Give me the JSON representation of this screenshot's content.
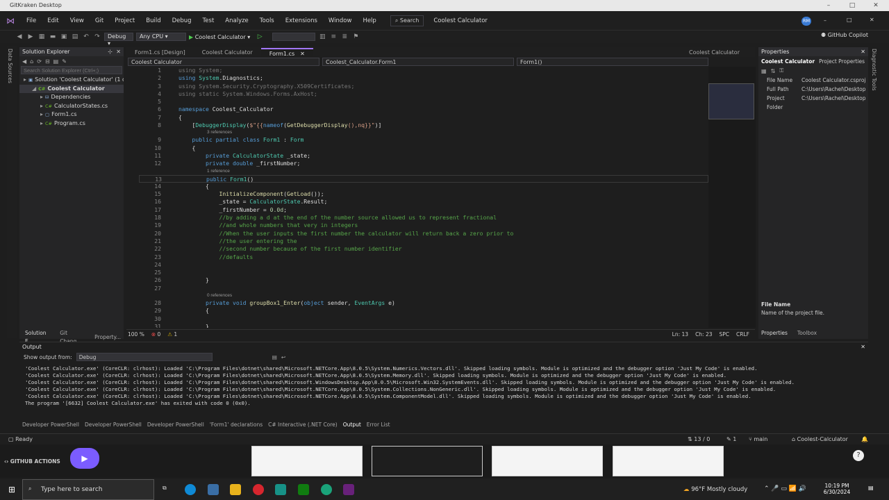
{
  "window": {
    "title": "GitKraken Desktop"
  },
  "menu": {
    "items": [
      "File",
      "Edit",
      "View",
      "Git",
      "Project",
      "Build",
      "Debug",
      "Test",
      "Analyze",
      "Tools",
      "Extensions",
      "Window",
      "Help"
    ],
    "search": "Search",
    "solution_name": "Coolest Calculator",
    "avatar": "RM",
    "copilot": "GitHub Copilot"
  },
  "toolbar": {
    "config": "Debug",
    "platform": "Any CPU",
    "run": "Coolest Calculator"
  },
  "left_strip": {
    "items": [
      "Data Sources",
      "Diagnostic Tools"
    ]
  },
  "solution_explorer": {
    "title": "Solution Explorer",
    "search_placeholder": "Search Solution Explorer (Ctrl+;)",
    "items": [
      {
        "label": "Solution 'Coolest Calculator' (1 of 1",
        "indent": 0,
        "icon": "solution-icon"
      },
      {
        "label": "Coolest Calculator",
        "indent": 1,
        "icon": "csharp-project-icon"
      },
      {
        "label": "Dependencies",
        "indent": 2,
        "icon": "dependencies-icon"
      },
      {
        "label": "CalculatorStates.cs",
        "indent": 2,
        "icon": "csharp-file-icon"
      },
      {
        "label": "Form1.cs",
        "indent": 2,
        "icon": "form-file-icon"
      },
      {
        "label": "Program.cs",
        "indent": 2,
        "icon": "csharp-file-icon"
      }
    ],
    "bottom_tabs": [
      "Solution E...",
      "Git Chang...",
      "Property..."
    ]
  },
  "editor": {
    "tabs": [
      "Form1.cs [Design]",
      "Coolest Calculator",
      "Form1.cs"
    ],
    "active_tab_index": 2,
    "right_tab": "Coolest Calculator",
    "nav": [
      "Coolest Calculator",
      "Coolest_Calculator.Form1",
      "Form1()"
    ],
    "lines": [
      {
        "n": "1",
        "t": [
          [
            "using ",
            "gr"
          ],
          [
            "System;",
            "gr"
          ]
        ]
      },
      {
        "n": "2",
        "t": [
          [
            "using ",
            "kw"
          ],
          [
            "System",
            "ty"
          ],
          [
            ".Diagnostics;",
            "d"
          ]
        ]
      },
      {
        "n": "3",
        "t": [
          [
            "using System.Security.Cryptography.X509Certificates;",
            "gr"
          ]
        ]
      },
      {
        "n": "4",
        "t": [
          [
            "using static System.Windows.Forms.AxHost;",
            "gr"
          ]
        ]
      },
      {
        "n": "5",
        "t": [
          [
            "",
            ""
          ]
        ]
      },
      {
        "n": "6",
        "t": [
          [
            "namespace ",
            "kw"
          ],
          [
            "Coolest_Calculator",
            "d"
          ]
        ]
      },
      {
        "n": "7",
        "t": [
          [
            "{",
            "d"
          ]
        ]
      },
      {
        "n": "8",
        "t": [
          [
            "    [",
            "d"
          ],
          [
            "DebuggerDisplay",
            "ty"
          ],
          [
            "(",
            "d"
          ],
          [
            "$\"{{",
            "st"
          ],
          [
            "nameof",
            "kw"
          ],
          [
            "(",
            "d"
          ],
          [
            "GetDebuggerDisplay",
            "mt"
          ],
          [
            "(),nq}}\"",
            "st"
          ],
          [
            ")]",
            "d"
          ]
        ]
      },
      {
        "ref": "3 references"
      },
      {
        "n": "9",
        "t": [
          [
            "    ",
            "d"
          ],
          [
            "public partial class ",
            "kw"
          ],
          [
            "Form1",
            "ty"
          ],
          [
            " : ",
            "d"
          ],
          [
            "Form",
            "ty"
          ]
        ]
      },
      {
        "n": "10",
        "t": [
          [
            "    {",
            "d"
          ]
        ]
      },
      {
        "n": "11",
        "t": [
          [
            "        ",
            "d"
          ],
          [
            "private ",
            "kw"
          ],
          [
            "CalculatorState",
            "ty"
          ],
          [
            " _state;",
            "d"
          ]
        ]
      },
      {
        "n": "12",
        "t": [
          [
            "        ",
            "d"
          ],
          [
            "private double ",
            "kw"
          ],
          [
            "_firstNumber;",
            "d"
          ]
        ]
      },
      {
        "ref": "1 reference"
      },
      {
        "n": "13",
        "t": [
          [
            "        ",
            "d"
          ],
          [
            "public ",
            "kw"
          ],
          [
            "Form1",
            "ty"
          ],
          [
            "()",
            "d"
          ]
        ]
      },
      {
        "n": "14",
        "t": [
          [
            "        {",
            "d"
          ]
        ]
      },
      {
        "n": "15",
        "t": [
          [
            "            ",
            "d"
          ],
          [
            "InitializeComponent",
            "mt"
          ],
          [
            "(",
            "d"
          ],
          [
            "GetLoad",
            "mt"
          ],
          [
            "());",
            "d"
          ]
        ]
      },
      {
        "n": "16",
        "t": [
          [
            "            _state = ",
            "d"
          ],
          [
            "CalculatorState",
            "ty"
          ],
          [
            ".Result;",
            "d"
          ]
        ]
      },
      {
        "n": "17",
        "t": [
          [
            "            _firstNumber = ",
            "d"
          ],
          [
            "0.0d",
            "nb"
          ],
          [
            ";",
            "d"
          ]
        ]
      },
      {
        "n": "18",
        "t": [
          [
            "            //by adding a d at the end of the number source allowed us to represent fractional",
            "cm"
          ]
        ]
      },
      {
        "n": "19",
        "t": [
          [
            "            //and whole numbers that very in integers",
            "cm"
          ]
        ]
      },
      {
        "n": "20",
        "t": [
          [
            "            //When the user inputs the first number the calculator will return back a zero prior to",
            "cm"
          ]
        ]
      },
      {
        "n": "21",
        "t": [
          [
            "            //the user entering the",
            "cm"
          ]
        ]
      },
      {
        "n": "22",
        "t": [
          [
            "            //second number because of the first number identifier",
            "cm"
          ]
        ]
      },
      {
        "n": "23",
        "t": [
          [
            "            //defaults",
            "cm"
          ]
        ]
      },
      {
        "n": "24",
        "t": [
          [
            "",
            ""
          ]
        ]
      },
      {
        "n": "25",
        "t": [
          [
            "",
            ""
          ]
        ]
      },
      {
        "n": "26",
        "t": [
          [
            "        }",
            "d"
          ]
        ]
      },
      {
        "n": "27",
        "t": [
          [
            "",
            ""
          ]
        ]
      },
      {
        "ref": "0 references"
      },
      {
        "n": "28",
        "t": [
          [
            "        ",
            "d"
          ],
          [
            "private void ",
            "kw"
          ],
          [
            "groupBox1_Enter",
            "mt"
          ],
          [
            "(",
            "d"
          ],
          [
            "object ",
            "kw"
          ],
          [
            "sender, ",
            "d"
          ],
          [
            "EventArgs",
            "ty"
          ],
          [
            " e)",
            "d"
          ]
        ]
      },
      {
        "n": "29",
        "t": [
          [
            "        {",
            "d"
          ]
        ]
      },
      {
        "n": "30",
        "t": [
          [
            "",
            ""
          ]
        ]
      },
      {
        "n": "31",
        "t": [
          [
            "        }",
            "d"
          ]
        ]
      }
    ],
    "status": {
      "zoom": "100 %",
      "errors": "0",
      "warnings": "1",
      "ln": "Ln: 13",
      "ch": "Ch: 23",
      "spc": "SPC",
      "crlf": "CRLF"
    }
  },
  "properties": {
    "title": "Properties",
    "object": "Coolest Calculator",
    "object_type": "Project Properties",
    "rows": [
      {
        "k": "File Name",
        "v": "Coolest Calculator.csproj"
      },
      {
        "k": "Full Path",
        "v": "C:\\Users\\Rachel\\Desktop"
      },
      {
        "k": "Project Folder",
        "v": "C:\\Users\\Rachel\\Desktop"
      }
    ],
    "desc_title": "File Name",
    "desc_text": "Name of the project file.",
    "bottom_tabs": [
      "Properties",
      "Toolbox"
    ]
  },
  "output": {
    "title": "Output",
    "show_from_label": "Show output from:",
    "show_from_value": "Debug",
    "lines": [
      "'Coolest Calculator.exe' (CoreCLR: clrhost): Loaded 'C:\\Program Files\\dotnet\\shared\\Microsoft.NETCore.App\\8.0.5\\System.Numerics.Vectors.dll'. Skipped loading symbols. Module is optimized and the debugger option 'Just My Code' is enabled.",
      "'Coolest Calculator.exe' (CoreCLR: clrhost): Loaded 'C:\\Program Files\\dotnet\\shared\\Microsoft.NETCore.App\\8.0.5\\System.Memory.dll'. Skipped loading symbols. Module is optimized and the debugger option 'Just My Code' is enabled.",
      "'Coolest Calculator.exe' (CoreCLR: clrhost): Loaded 'C:\\Program Files\\dotnet\\shared\\Microsoft.WindowsDesktop.App\\8.0.5\\Microsoft.Win32.SystemEvents.dll'. Skipped loading symbols. Module is optimized and the debugger option 'Just My Code' is enabled.",
      "'Coolest Calculator.exe' (CoreCLR: clrhost): Loaded 'C:\\Program Files\\dotnet\\shared\\Microsoft.NETCore.App\\8.0.5\\System.Collections.NonGeneric.dll'. Skipped loading symbols. Module is optimized and the debugger option 'Just My Code' is enabled.",
      "'Coolest Calculator.exe' (CoreCLR: clrhost): Loaded 'C:\\Program Files\\dotnet\\shared\\Microsoft.NETCore.App\\8.0.5\\System.ComponentModel.dll'. Skipped loading symbols. Module is optimized and the debugger option 'Just My Code' is enabled.",
      "The program '[6632] Coolest Calculator.exe' has exited with code 0 (0x0)."
    ],
    "bottom_tabs": [
      "Developer PowerShell",
      "Developer PowerShell",
      "Developer PowerShell",
      "'Form1' declarations",
      "C# Interactive (.NET Core)",
      "Output",
      "Error List"
    ],
    "active_bottom_tab": 5
  },
  "statusbar": {
    "ready": "Ready",
    "changes": "13 / 0",
    "edits": "1",
    "branch": "main",
    "repo": "Coolest-Calculator"
  },
  "gitkraken": {
    "actions_label": "GITHUB ACTIONS",
    "help": "?"
  },
  "taskbar": {
    "search_placeholder": "Type here to search",
    "weather": "96°F  Mostly cloudy",
    "time": "10:19 PM",
    "date": "6/30/2024"
  },
  "colors": {
    "accent": "#a277ff",
    "vs_purple": "#68217a",
    "gk_purple": "#7b5cff"
  }
}
